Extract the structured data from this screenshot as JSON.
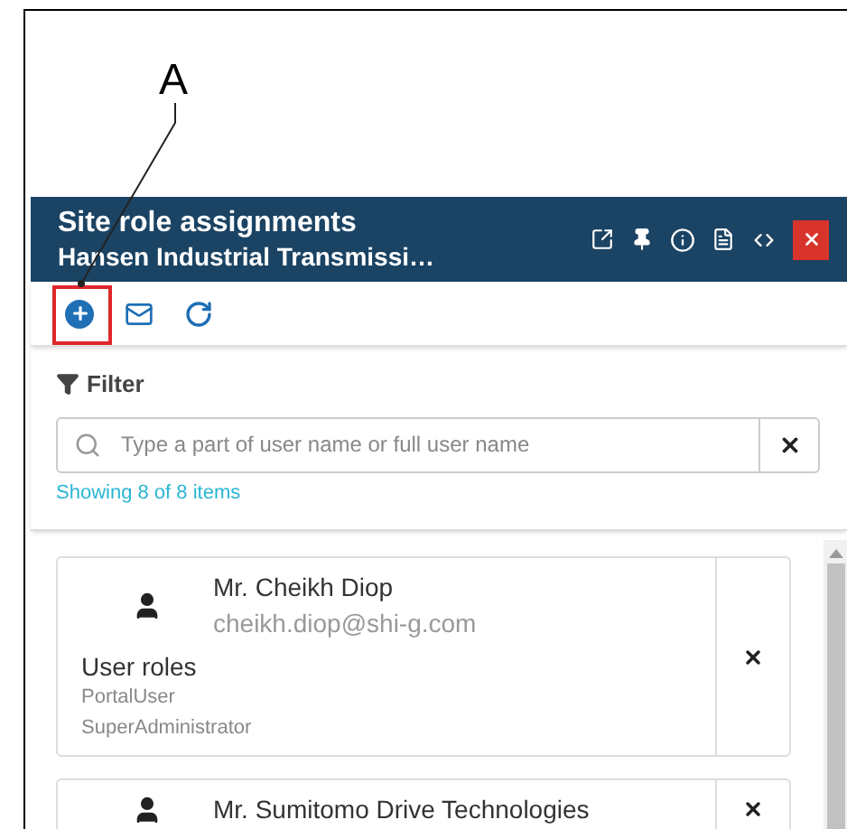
{
  "callout": {
    "label": "A"
  },
  "panel": {
    "title": "Site role assignments",
    "subtitle": "Hansen Industrial Transmissi…"
  },
  "filter": {
    "label": "Filter",
    "placeholder": "Type a part of user name or full user name",
    "count": "Showing 8 of 8 items"
  },
  "users": [
    {
      "name": "Mr. Cheikh Diop",
      "email": "cheikh.diop@shi-g.com",
      "roles_label": "User roles",
      "roles": [
        "PortalUser",
        "SuperAdministrator"
      ]
    },
    {
      "name": "Mr. Sumitomo Drive Technologies"
    }
  ]
}
